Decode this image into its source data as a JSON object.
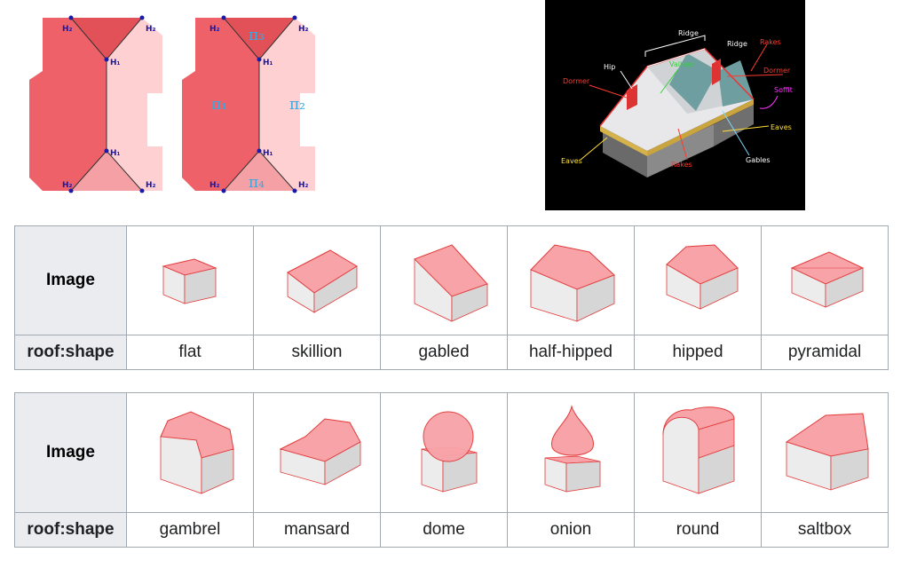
{
  "plan_figure": {
    "h1_label": "H₁",
    "h2_label": "H₂",
    "face_labels": [
      "π₁",
      "π₂",
      "π₃",
      "π₄"
    ]
  },
  "anatomy_figure": {
    "labels": {
      "ridge_left": "Ridge",
      "ridge_right": "Ridge",
      "rakes_top": "Rakes",
      "hip": "Hip",
      "valleys": "Valleys",
      "dormer_left": "Dormer",
      "dormer_right": "Dormer",
      "soffit": "Soffit",
      "eaves_right": "Eaves",
      "eaves_left": "Eaves",
      "rakes_bottom": "Rakes",
      "gables": "Gables"
    },
    "colors": {
      "white_label": "#ffffff",
      "red_label": "#ff3b30",
      "green_label": "#36d13b",
      "yellow_label": "#ffe13a",
      "magenta_label": "#ff33ff",
      "cyan_label": "#7fd6ff"
    }
  },
  "tables": [
    {
      "header_label": "Image",
      "key_label": "roof:shape",
      "shapes": [
        {
          "value": "flat",
          "icon": "flat-roof-icon"
        },
        {
          "value": "skillion",
          "icon": "skillion-roof-icon"
        },
        {
          "value": "gabled",
          "icon": "gabled-roof-icon"
        },
        {
          "value": "half-hipped",
          "icon": "half-hipped-roof-icon"
        },
        {
          "value": "hipped",
          "icon": "hipped-roof-icon"
        },
        {
          "value": "pyramidal",
          "icon": "pyramidal-roof-icon"
        }
      ]
    },
    {
      "header_label": "Image",
      "key_label": "roof:shape",
      "shapes": [
        {
          "value": "gambrel",
          "icon": "gambrel-roof-icon"
        },
        {
          "value": "mansard",
          "icon": "mansard-roof-icon"
        },
        {
          "value": "dome",
          "icon": "dome-roof-icon"
        },
        {
          "value": "onion",
          "icon": "onion-roof-icon"
        },
        {
          "value": "round",
          "icon": "round-roof-icon"
        },
        {
          "value": "saltbox",
          "icon": "saltbox-roof-icon"
        }
      ]
    }
  ],
  "colors": {
    "roof_fill": "#f7a3a8",
    "roof_stroke": "#e23a3a",
    "wall_fill": "#e6e6e6",
    "wall_side": "#d4d4d4",
    "link_blue": "#0645ad",
    "header_bg": "#eaecf0"
  }
}
